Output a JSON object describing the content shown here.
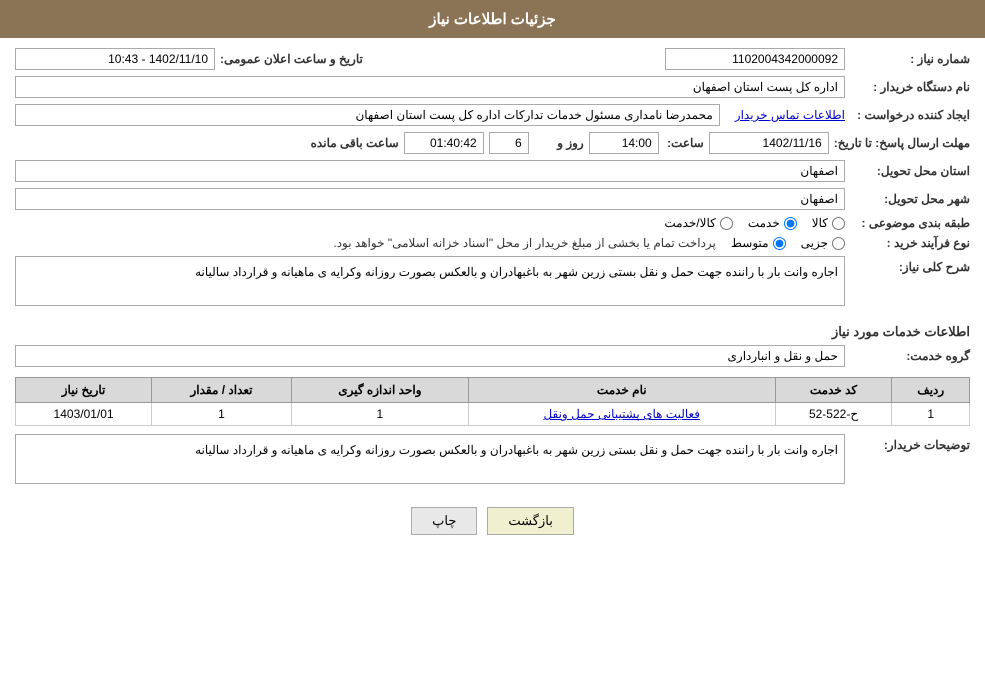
{
  "header": {
    "title": "جزئیات اطلاعات نیاز"
  },
  "form": {
    "shomareNiaz_label": "شماره نیاز :",
    "shomareNiaz_value": "1102004342000092",
    "namDastgah_label": "نام دستگاه خریدار :",
    "namDastgah_value": "اداره کل پست استان اصفهان",
    "tarikh_label": "تاریخ و ساعت اعلان عمومی:",
    "tarikh_value": "1402/11/10 - 10:43",
    "ijadKonande_label": "ایجاد کننده درخواست :",
    "ijadKonande_value": "محمدرضا نامداری مسئول خدمات تداركات اداره كل پست استان اصفهان",
    "ettelaat_link": "اطلاعات تماس خریدار",
    "mohlatIrsalLabel": "مهلت ارسال پاسخ: تا تاریخ:",
    "mohlatDate": "1402/11/16",
    "mohlatSaatLabel": "ساعت:",
    "mohlatSaat": "14:00",
    "mohlatRozLabel": "روز و",
    "mohlatRoz": "6",
    "mohlatBaqiLabel": "ساعت باقی مانده",
    "mohlatBaqi": "01:40:42",
    "ostanTahvilLabel": "استان محل تحویل:",
    "ostanTahvil": "اصفهان",
    "shahrTahvilLabel": "شهر محل تحویل:",
    "shahrTahvil": "اصفهان",
    "tabebandiLabel": "طبقه بندی موضوعی :",
    "tabebandi_options": [
      "کالا",
      "خدمت",
      "کالا/خدمت"
    ],
    "tabebandi_selected": "خدمت",
    "noeFarayandLabel": "نوع فرآیند خرید :",
    "noeFarayand_options": [
      "جزیی",
      "متوسط"
    ],
    "noeFarayand_selected": "متوسط",
    "noeFarayandNote": "پرداخت تمام یا بخشی از مبلغ خریدار از محل \"اسناد خزانه اسلامی\" خواهد بود.",
    "sharhKolliLabel": "شرح کلی نیاز:",
    "sharhKolli": "اجاره وانت بار با راننده جهت حمل و نقل بستی  زرین شهر به باغبهادران و بالعکس بصورت روزانه وکرایه ی ماهیانه و قرارداد سالیانه",
    "ettelaatKhadamatLabel": "اطلاعات خدمات مورد نیاز",
    "grohKhadamatLabel": "گروه خدمت:",
    "grohKhadamat": "حمل و نقل و انبارداری",
    "tableHeaders": {
      "radif": "ردیف",
      "kodKhadamat": "کد خدمت",
      "namKhadamat": "نام خدمت",
      "vahedAndaze": "واحد اندازه گیری",
      "tedadMeqdar": "تعداد / مقدار",
      "tarikhNiaz": "تاریخ نیاز"
    },
    "tableRows": [
      {
        "radif": "1",
        "kodKhadamat": "ح-522-52",
        "namKhadamat": "فعالیت های پشتیبانی حمل ونقل",
        "vahedAndaze": "1",
        "tedadMeqdar": "1",
        "tarikhNiaz": "1403/01/01"
      }
    ],
    "توضیحاتLabel": "توضیحات خریدار:",
    "توضیحاتValue": "اجاره وانت بار با راننده جهت حمل و نقل بستی  زرین شهر به باغبهادران و بالعکس بصورت روزانه وکرایه ی ماهیانه و قرارداد سالیانه",
    "btnPrint": "چاپ",
    "btnBack": "بازگشت"
  }
}
